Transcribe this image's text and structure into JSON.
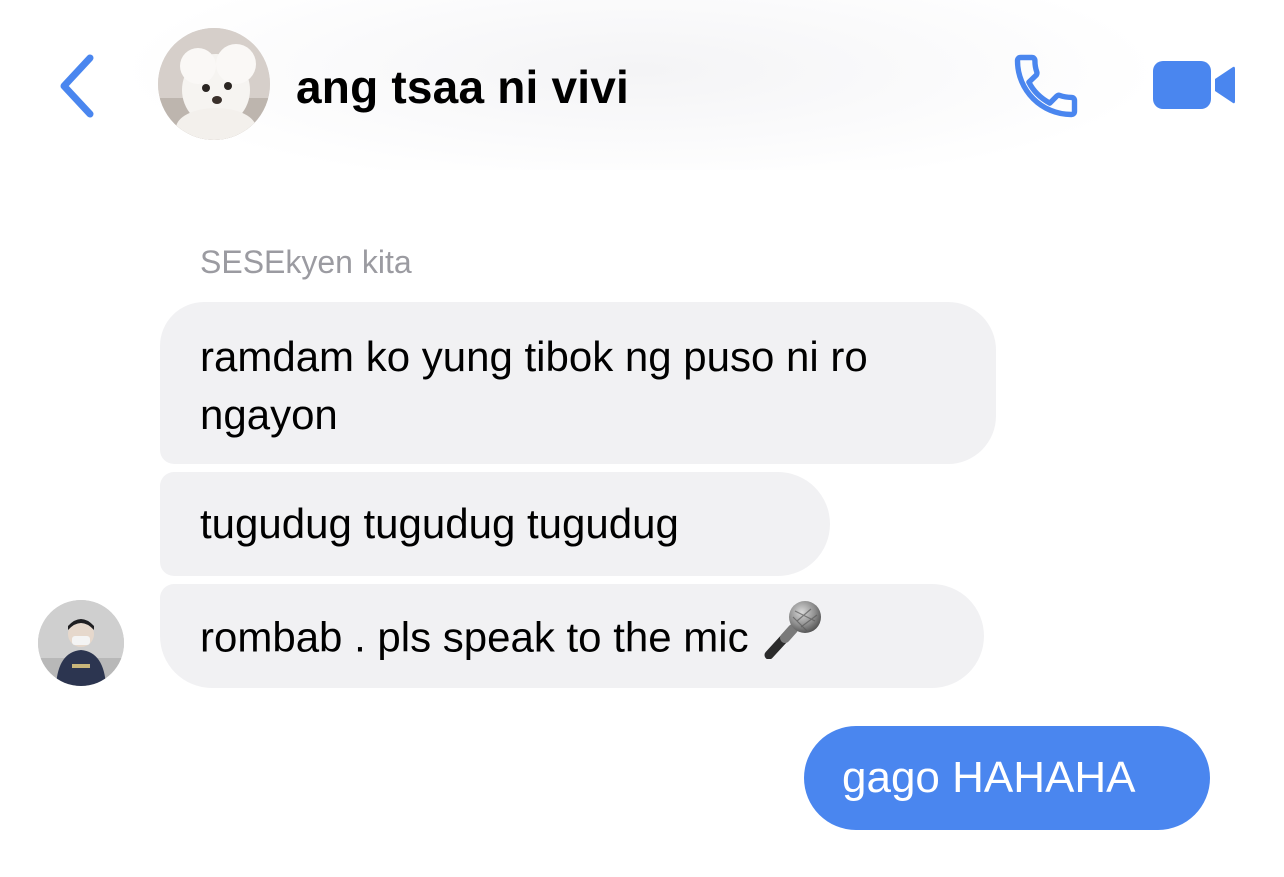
{
  "header": {
    "title": "ang tsaa ni vivi",
    "back_icon": "chevron-left-icon",
    "call_icon": "phone-icon",
    "video_icon": "video-camera-icon",
    "accent_color": "#4a86ef"
  },
  "conversation": {
    "sender_name": "SESEkyen kita",
    "incoming": [
      {
        "text": "ramdam ko yung tibok ng puso ni ro ngayon"
      },
      {
        "text": "tugudug tugudug tugudug"
      },
      {
        "text": "rombab . pls speak to the mic",
        "emoji": "microphone-icon"
      }
    ],
    "outgoing": [
      {
        "text": "gago HAHAHA"
      }
    ],
    "incoming_bubble_color": "#f1f1f3",
    "outgoing_bubble_color": "#4a86ef"
  }
}
